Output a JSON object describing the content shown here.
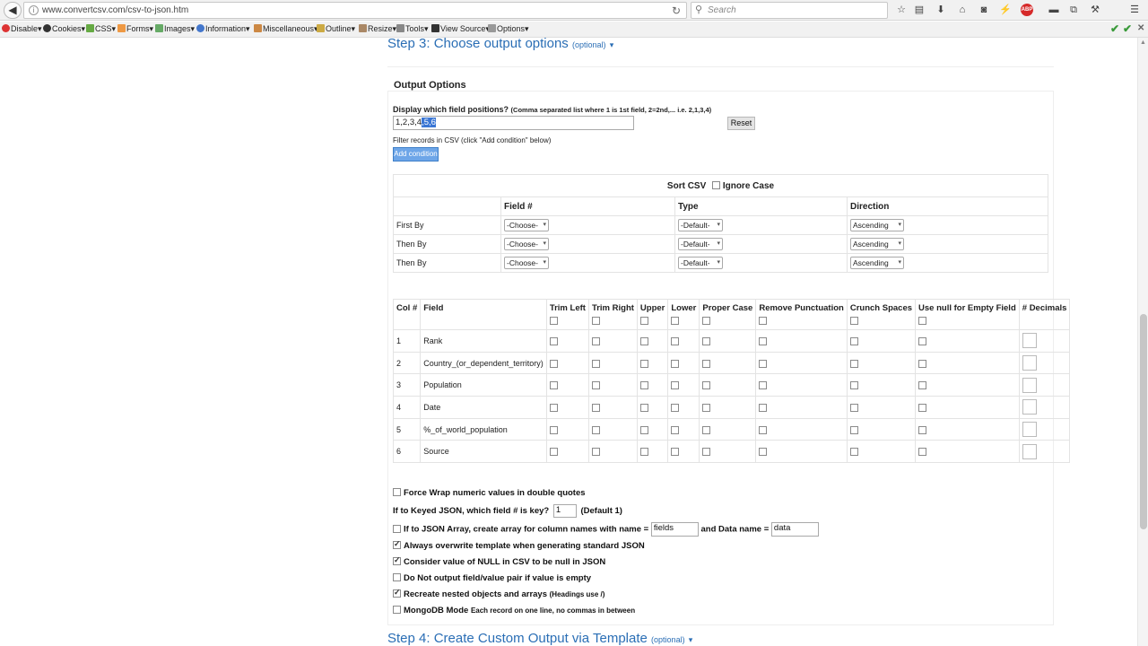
{
  "browser": {
    "url": "www.convertcsv.com/csv-to-json.htm",
    "search_placeholder": "Search"
  },
  "devbar": {
    "items": [
      "Disable▾",
      "Cookies▾",
      "CSS▾",
      "Forms▾",
      "Images▾",
      "Information▾",
      "Miscellaneous▾",
      "Outline▾",
      "Resize▾",
      "Tools▾",
      "View Source▾",
      "Options▾"
    ]
  },
  "step3": {
    "title": "Step 3: Choose output options",
    "optional": "(optional)"
  },
  "step4": {
    "title": "Step 4: Create Custom Output via Template",
    "optional": "(optional)"
  },
  "output_options": {
    "heading": "Output Options",
    "positions_label": "Display which field positions?",
    "positions_hint": "(Comma separated list where 1 is 1st field, 2=2nd,... i.e. 2,1,3,4)",
    "positions_value": "1,2,3,4",
    "positions_selected": ",5,6",
    "reset_label": "Reset",
    "filter_label": "Filter records in CSV (click \"Add condition\" below)",
    "add_condition_label": "Add condition"
  },
  "sort": {
    "title": "Sort CSV",
    "ignore_case": "Ignore Case",
    "headers": [
      "Field #",
      "Type",
      "Direction"
    ],
    "rows": [
      {
        "label": "First By",
        "field": "-Choose-",
        "type": "-Default-",
        "direction": "Ascending"
      },
      {
        "label": "Then By",
        "field": "-Choose-",
        "type": "-Default-",
        "direction": "Ascending"
      },
      {
        "label": "Then By",
        "field": "-Choose-",
        "type": "-Default-",
        "direction": "Ascending"
      }
    ]
  },
  "fields": {
    "headers": [
      "Col #",
      "Field",
      "Trim Left",
      "Trim Right",
      "Upper",
      "Lower",
      "Proper Case",
      "Remove Punctuation",
      "Crunch Spaces",
      "Use null for Empty Field",
      "# Decimals"
    ],
    "rows": [
      {
        "col": "1",
        "name": "Rank"
      },
      {
        "col": "2",
        "name": "Country_(or_dependent_territory)"
      },
      {
        "col": "3",
        "name": "Population"
      },
      {
        "col": "4",
        "name": "Date"
      },
      {
        "col": "5",
        "name": "%_of_world_population"
      },
      {
        "col": "6",
        "name": "Source"
      }
    ]
  },
  "options": {
    "force_wrap": "Force Wrap numeric values in double quotes",
    "keyed_json": "If to Keyed JSON, which field # is key?",
    "keyed_value": "1",
    "keyed_default": "(Default 1)",
    "json_array": "If to JSON Array, create array for column names with name =",
    "json_array_name": "fields",
    "data_name_label": "and Data name =",
    "data_name_value": "data",
    "overwrite": "Always overwrite template when generating standard JSON",
    "null_value": "Consider value of NULL in CSV to be null in JSON",
    "no_empty": "Do Not output field/value pair if value is empty",
    "nested": "Recreate nested objects and arrays",
    "nested_hint": "(Headings use /)",
    "mongodb": "MongoDB Mode",
    "mongodb_hint": "Each record on one line, no commas in between"
  }
}
